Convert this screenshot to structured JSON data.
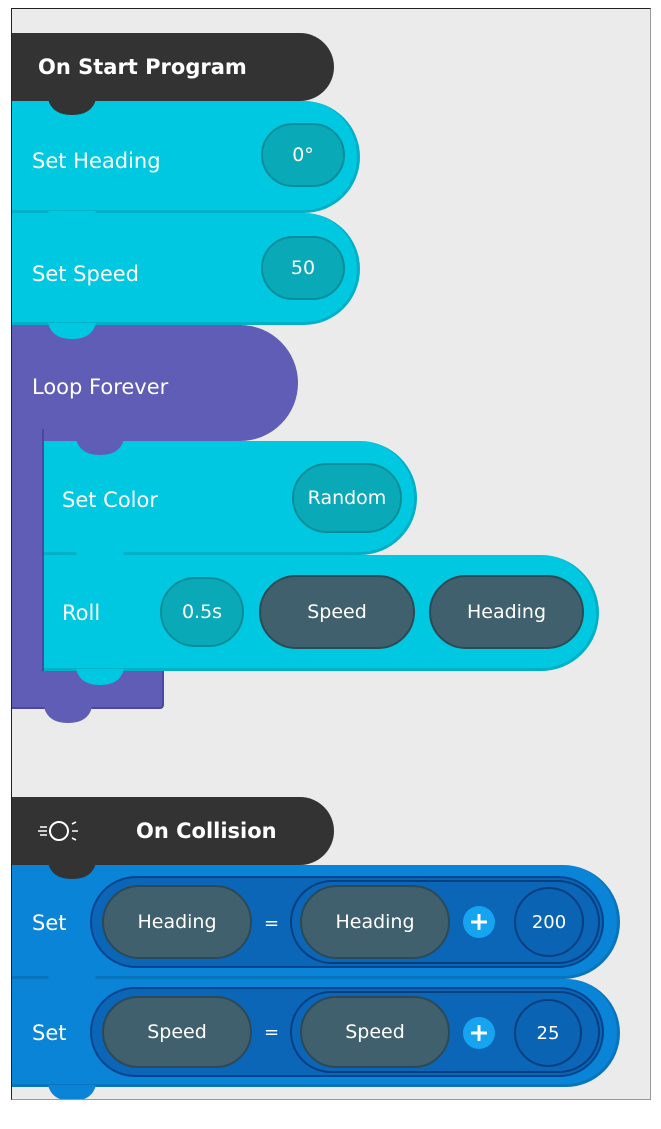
{
  "program_start": {
    "title": "On Start Program",
    "blocks": [
      {
        "label": "Set Heading",
        "value": "0°"
      },
      {
        "label": "Set Speed",
        "value": "50"
      }
    ],
    "loop": {
      "label": "Loop Forever",
      "blocks": [
        {
          "label": "Set Color",
          "value": "Random"
        },
        {
          "label": "Roll",
          "duration": "0.5s",
          "speed": "Speed",
          "heading": "Heading"
        }
      ]
    }
  },
  "collision": {
    "title": "On Collision",
    "icon": "collision-icon",
    "blocks": [
      {
        "label": "Set",
        "target": "Heading",
        "equals": "=",
        "source": "Heading",
        "operator": "plus",
        "amount": "200"
      },
      {
        "label": "Set",
        "target": "Speed",
        "equals": "=",
        "source": "Speed",
        "operator": "plus",
        "amount": "25"
      }
    ]
  },
  "colors": {
    "event_block": "#333333",
    "motion_block": "#00c8e0",
    "control_block": "#5f5db5",
    "operator_block": "#0a84d6",
    "value_pill": "#0aa9b8",
    "variable_pill": "#3f606c",
    "plus_button": "#16a4f0"
  }
}
